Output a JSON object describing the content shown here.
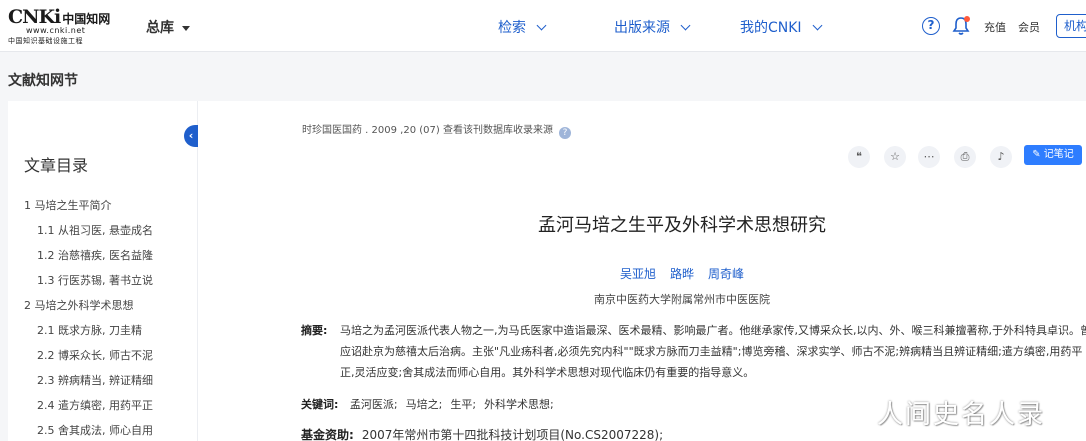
{
  "header": {
    "logo_main": "CNKi",
    "logo_cn": "中国知网",
    "logo_url": "www.cnki.net",
    "logo_sub": "中国知识基础设施工程",
    "zongku": "总库",
    "nav": [
      "检索",
      "出版来源",
      "我的CNKI"
    ],
    "help": "?",
    "chongzhi": "充值",
    "huiyuan": "会员",
    "org": "机构"
  },
  "page_title": "文献知网节",
  "sidebar": {
    "title": "文章目录",
    "collapse": "‹",
    "items": [
      {
        "label": "1 马培之生平简介",
        "level": 1
      },
      {
        "label": "1.1 从祖习医, 悬壶成名",
        "level": 2
      },
      {
        "label": "1.2 治慈禧疾, 医名益隆",
        "level": 2
      },
      {
        "label": "1.3 行医苏锡, 著书立说",
        "level": 2
      },
      {
        "label": "2 马培之外科学术思想",
        "level": 1
      },
      {
        "label": "2.1 既求方脉, 刀圭精",
        "level": 2
      },
      {
        "label": "2.2 博采众长, 师古不泥",
        "level": 2
      },
      {
        "label": "2.3 辨病精当, 辨证精细",
        "level": 2
      },
      {
        "label": "2.4 遣方缜密, 用药平正",
        "level": 2
      },
      {
        "label": "2.5 舍其成法, 师心自用",
        "level": 2
      }
    ]
  },
  "article": {
    "source": "时珍国医国药 . 2009 ,20 (07)  查看该刊数据库收录来源",
    "note_button": "记笔记",
    "title": "孟河马培之生平及外科学术思想研究",
    "authors": [
      "吴亚旭",
      "路晔",
      "周奇峰"
    ],
    "affiliation": "南京中医药大学附属常州市中医医院",
    "abstract_label": "摘要:",
    "abstract": "马培之为孟河医派代表人物之一,为马氏医家中造诣最深、医术最精、影响最广者。他继承家传,又博采众长,以内、外、喉三科兼擅著称,于外科特具卓识。曾应诏赴京为慈禧太后治病。主张\"凡业疡科者,必须先究内科\"\"既求方脉而刀圭益精\";博览旁稽、深求实学、师古不泥;辨病精当且辨证精细;遣方缜密,用药平正,灵活应变;舍其成法而师心自用。其外科学术思想对现代临床仍有重要的指导意义。",
    "keywords_label": "关键词:",
    "keywords": [
      "孟河医派;",
      "马培之;",
      "生平;",
      "外科学术思想;"
    ],
    "fund_label": "基金资助:",
    "fund": "2007年常州市第十四批科技计划项目(No.CS2007228);"
  },
  "toolbar_icons": [
    "quote-icon",
    "star-icon",
    "share-icon",
    "print-icon",
    "bell-icon"
  ],
  "toolbar_glyphs": [
    "❝",
    "☆",
    "⋯",
    "⎙",
    "♪"
  ],
  "watermark": "人间史名人录",
  "colors": {
    "accent": "#1f5fcc",
    "note": "#2e7dff"
  }
}
